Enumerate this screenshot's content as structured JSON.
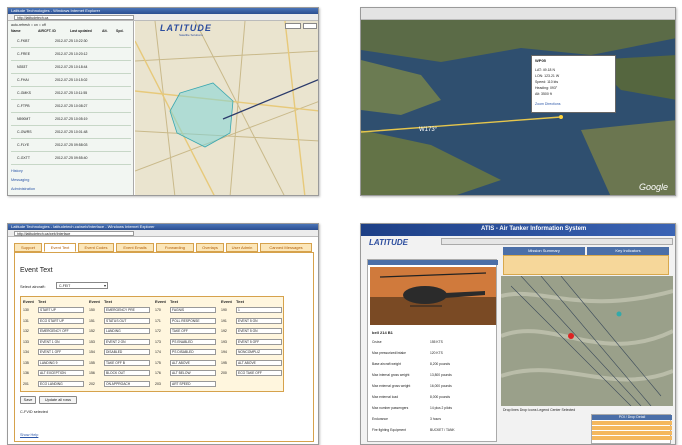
{
  "s1": {
    "title": "Latitude Technologies - Windows Internet Explorer",
    "url": "http://latitudetech.ca",
    "logo": "LATITUDE",
    "logo_sub": "Satellite Solutions",
    "filter": "auto-refresh ○ on ○ off",
    "col_headers": [
      "Name",
      "AIRCFT. ID",
      "Last updated",
      "Alt.",
      "Spd."
    ],
    "rows": [
      {
        "name": "C-FKBT",
        "time": "2012-07-25 10:22:30"
      },
      {
        "name": "C-FREE",
        "time": "2012-07-25 10:20:12"
      },
      {
        "name": "N353T",
        "time": "2012-07-25 10:18:44"
      },
      {
        "name": "C-FHAI",
        "time": "2012-07-25 10:15:02"
      },
      {
        "name": "C-GMKS",
        "time": "2012-07-25 10:11:55"
      },
      {
        "name": "C-FTPB",
        "time": "2012-07-25 10:08:27"
      },
      {
        "name": "N590MT",
        "time": "2012-07-25 10:05:19"
      },
      {
        "name": "C-GWRS",
        "time": "2012-07-25 10:01:48"
      },
      {
        "name": "C-FLYE",
        "time": "2012-07-25 09:58:03"
      },
      {
        "name": "C-GXTT",
        "time": "2012-07-25 09:55:40"
      }
    ],
    "sections": [
      "History",
      "Messaging",
      "Administration"
    ]
  },
  "s2": {
    "wpt": "W173°",
    "popup_title": "WP05",
    "popup_lines": [
      "LAT: 49.18 N",
      "LON: 123.21 W",
      "Speed: 110 kts",
      "Heading: 093°",
      "Alt: 3500 ft"
    ],
    "popup_link": "Zoom  Directions",
    "google": "Google"
  },
  "s3": {
    "title": "Latitude Technologies - latitudetech.ca/web/Interface - Windows Internet Explorer",
    "url": "http://latitudetech.ca/web/Interface",
    "tabs": [
      "Support",
      "Event Text",
      "Event Codes",
      "Event Emails",
      "Forwarding",
      "Overlays",
      "User Admin",
      "Canned Messages"
    ],
    "heading": "Event Text",
    "select_label": "Select aircraft:",
    "select_value": "C-FEIT",
    "gh": [
      "Event",
      "Text",
      "Event",
      "Text",
      "Event",
      "Text",
      "Event",
      "Text"
    ],
    "cols": [
      [
        {
          "n": "130",
          "t": "START UP"
        },
        {
          "n": "131",
          "t": "ECO START UP"
        },
        {
          "n": "132",
          "t": "EMERGENCY OFF"
        },
        {
          "n": "133",
          "t": "EVENT 1 ON"
        },
        {
          "n": "134",
          "t": "EVENT 1 OFF"
        },
        {
          "n": "135",
          "t": "LANDING 9"
        },
        {
          "n": "136",
          "t": "ALT EXCEPTION"
        },
        {
          "n": "201",
          "t": "ECO LANDING"
        }
      ],
      [
        {
          "n": "150",
          "t": "EMERGENCY PRE"
        },
        {
          "n": "151",
          "t": "STATUS OUT"
        },
        {
          "n": "152",
          "t": "LANDING"
        },
        {
          "n": "153",
          "t": "EVENT 2 ON"
        },
        {
          "n": "154",
          "t": "DISABLED"
        },
        {
          "n": "155",
          "t": "TAKE OFF B"
        },
        {
          "n": "156",
          "t": "BLOCK OUT"
        },
        {
          "n": "202",
          "t": "ON APPROACH"
        }
      ],
      [
        {
          "n": "170",
          "t": "FAGNIS"
        },
        {
          "n": "171",
          "t": "POLL RESPONSE"
        },
        {
          "n": "172",
          "t": "TAKE OFF"
        },
        {
          "n": "173",
          "t": "PS ENABLED"
        },
        {
          "n": "174",
          "t": "PS DISABLED"
        },
        {
          "n": "175",
          "t": "ALT ABOVE"
        },
        {
          "n": "176",
          "t": "ALT BELOW"
        },
        {
          "n": "203",
          "t": "ART SPEED"
        }
      ],
      [
        {
          "n": "190",
          "t": "1"
        },
        {
          "n": "191",
          "t": "EVENT 5 ON"
        },
        {
          "n": "192",
          "t": "EVENT 5 ON"
        },
        {
          "n": "193",
          "t": "EVENT 5 OFF"
        },
        {
          "n": "194",
          "t": "NONCOMPLIZ"
        },
        {
          "n": "195",
          "t": "ALT ABOVE"
        },
        {
          "n": "200",
          "t": "ECO TAKE OFF"
        }
      ]
    ],
    "save": "Save",
    "update": "Update all rows",
    "note": "C-FVID selected",
    "help": "Show Help"
  },
  "s4": {
    "banner": "ATIS - Air Tanker Information System",
    "logo": "LATITUDE",
    "tab1": "Mission Summary",
    "tab2": "Key Indicators",
    "heli_name": "bell 214 B1",
    "specs": [
      {
        "k": "Cruise",
        "v": "155 KTS"
      },
      {
        "k": "Max pressurized/intake",
        "v": "120 KTS"
      },
      {
        "k": "Base aircraft weight",
        "v": "8,200 pounds"
      },
      {
        "k": "Max internal gross weight",
        "v": "13,800 pounds"
      },
      {
        "k": "Max external gross weight",
        "v": "16,000 pounds"
      },
      {
        "k": "Max external load",
        "v": "8,000 pounds"
      },
      {
        "k": "Max number passengers",
        "v": "14 plus 2 pilots"
      },
      {
        "k": "Endurance",
        "v": "3 hours"
      },
      {
        "k": "Fire fighting Equipment",
        "v": "BUCKET / TANK"
      }
    ],
    "legend": "Drop lines   Drop icons   Legend   Center   Selected",
    "table_title": "POI / Drop Detail"
  }
}
